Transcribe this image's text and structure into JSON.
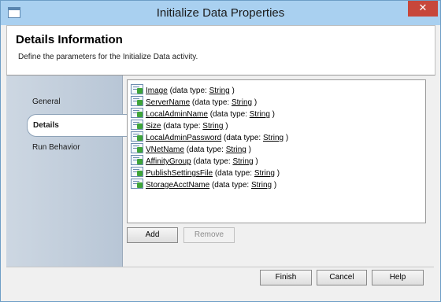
{
  "window": {
    "title": "Initialize Data Properties",
    "close_glyph": "✕"
  },
  "header": {
    "title": "Details Information",
    "description": "Define the parameters for the Initialize Data activity."
  },
  "nav": {
    "items": [
      {
        "label": "General"
      },
      {
        "label": "Details"
      },
      {
        "label": "Run Behavior"
      }
    ],
    "selected": "Details"
  },
  "params": {
    "data_type_prefix": "(data type:",
    "data_type_suffix": ")",
    "items": [
      {
        "name": "Image",
        "type": "String"
      },
      {
        "name": "ServerName",
        "type": "String"
      },
      {
        "name": "LocalAdminName",
        "type": "String"
      },
      {
        "name": "Size",
        "type": "String"
      },
      {
        "name": "LocalAdminPassword",
        "type": "String"
      },
      {
        "name": "VNetName",
        "type": "String"
      },
      {
        "name": "AffinityGroup",
        "type": "String"
      },
      {
        "name": "PublishSettingsFile",
        "type": "String"
      },
      {
        "name": "StorageAcctName",
        "type": "String"
      }
    ]
  },
  "list_buttons": {
    "add": "Add",
    "remove": "Remove"
  },
  "footer_buttons": {
    "finish": "Finish",
    "cancel": "Cancel",
    "help": "Help"
  }
}
